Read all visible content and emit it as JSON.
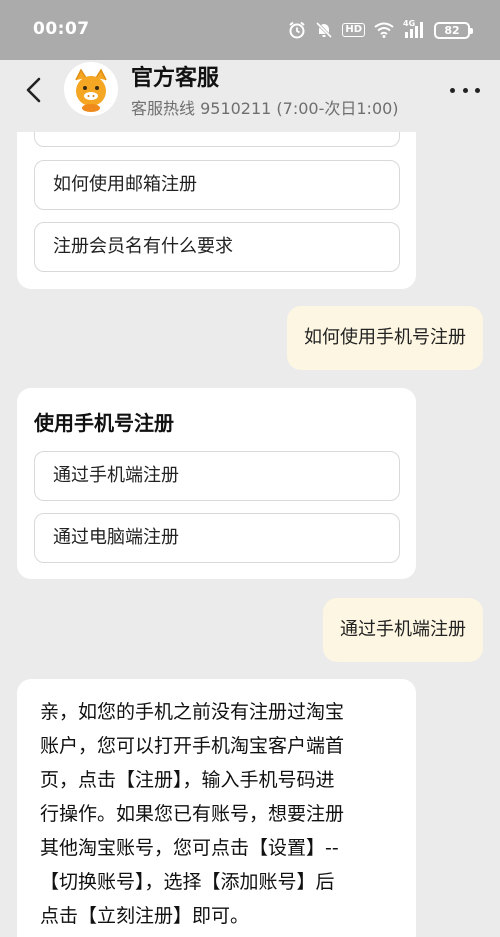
{
  "status_bar": {
    "time": "00:07",
    "network": "4G",
    "battery": "82",
    "hd": "HD"
  },
  "header": {
    "title": "官方客服",
    "subtitle": "客服热线 9510211 (7:00-次日1:00)"
  },
  "chat": {
    "card1_options": [
      "如何使用邮箱注册",
      "注册会员名有什么要求"
    ],
    "user_msg1": "如何使用手机号注册",
    "card2": {
      "title": "使用手机号注册",
      "options": [
        "通过手机端注册",
        "通过电脑端注册"
      ]
    },
    "user_msg2": "通过手机端注册",
    "reply_lines": [
      "亲，如您的手机之前没有注册过淘宝",
      "账户，您可以打开手机淘宝客户端首",
      "页，点击【注册】，输入手机号码进",
      "行操作。如果您已有账号，想要注册",
      "其他淘宝账号，您可点击【设置】--",
      "【切换账号】，选择【添加账号】后",
      "点击【立刻注册】即可。"
    ]
  },
  "colors": {
    "status_bar_bg": "#ababab",
    "page_bg": "#ebebeb",
    "user_bubble_bg": "#fdf6e2",
    "card_bg": "#ffffff"
  }
}
